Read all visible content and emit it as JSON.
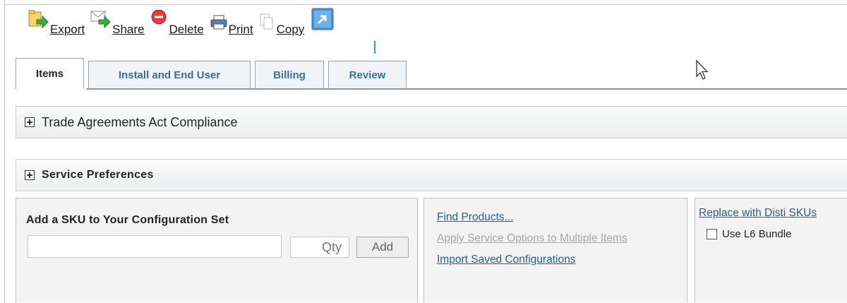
{
  "toolbar": {
    "export_label": "Export",
    "share_label": "Share",
    "delete_label": "Delete",
    "print_label": "Print",
    "copy_label": "Copy",
    "icons": [
      "export-icon",
      "share-icon",
      "delete-icon",
      "print-icon",
      "copy-icon",
      "expand-icon"
    ]
  },
  "tabs": [
    {
      "label": "Items",
      "active": true
    },
    {
      "label": "Install and End User",
      "active": false
    },
    {
      "label": "Billing",
      "active": false
    },
    {
      "label": "Review",
      "active": false
    }
  ],
  "sections": {
    "trade": "Trade Agreements Act Compliance",
    "service": "Service Preferences"
  },
  "add_sku": {
    "title": "Add a SKU to Your Configuration Set",
    "sku_value": "",
    "qty_placeholder": "Qty",
    "add_label": "Add"
  },
  "links": {
    "find_products": "Find Products...",
    "apply_service": "Apply Service Options to Multiple Items",
    "import_configs": "Import Saved Configurations"
  },
  "disti": {
    "replace_label": "Replace with Disti SKUs",
    "bundle_label": "Use L6 Bundle",
    "bundle_checked": false
  },
  "colors": {
    "link": "#1f5f9e",
    "tab_text": "#3a6ea5",
    "delete_red": "#e23b3b",
    "panel_bg": "#f3f3f3"
  }
}
